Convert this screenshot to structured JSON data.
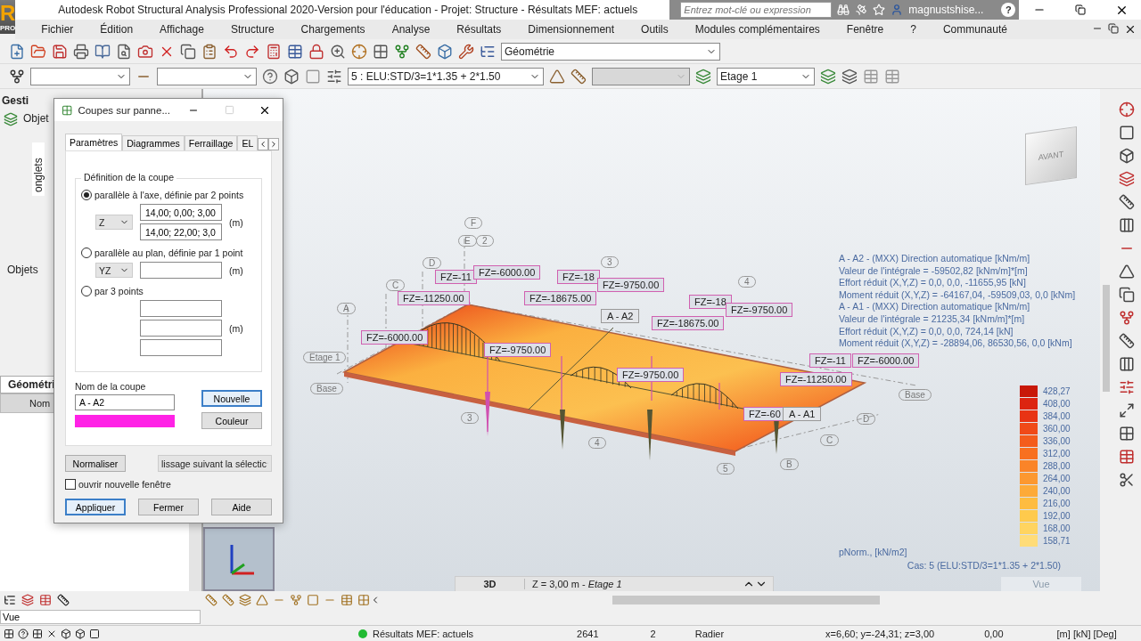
{
  "app": {
    "logo": "R",
    "edition": "PRO"
  },
  "window": {
    "title": "Autodesk Robot Structural Analysis Professional 2020-Version pour l'éducation - Projet: Structure - Résultats MEF: actuels",
    "search_placeholder": "Entrez mot-clé ou expression",
    "user": "magnustshise...",
    "help": "?"
  },
  "menu": [
    {
      "label": "Fichier"
    },
    {
      "label": "Édition"
    },
    {
      "label": "Affichage"
    },
    {
      "label": "Structure"
    },
    {
      "label": "Chargements"
    },
    {
      "label": "Analyse"
    },
    {
      "label": "Résultats"
    },
    {
      "label": "Dimensionnement"
    },
    {
      "label": "Outils"
    },
    {
      "label": "Modules complémentaires"
    },
    {
      "label": "Fenêtre"
    },
    {
      "label": "?"
    },
    {
      "label": "Communauté"
    }
  ],
  "toolbar": {
    "layout_combo": "Géométrie",
    "case_combo": "5 : ELU:STD/3=1*1.35 + 2*1.50",
    "story_combo": "Etage 1"
  },
  "left_panel": {
    "title": "Gesti",
    "side_tab": "onglets",
    "tree_header": "Objet",
    "tree": [
      {
        "label": "Objets"
      }
    ],
    "tab": "Géométri",
    "column": "Nom"
  },
  "dialog": {
    "title": "Coupes sur panne...",
    "tabs": [
      {
        "label": "Paramètres",
        "selected": true
      },
      {
        "label": "Diagrammes",
        "selected": false
      },
      {
        "label": "Ferraillage",
        "selected": false
      },
      {
        "label": "EL",
        "selected": false
      }
    ],
    "group_title": "Définition de la coupe",
    "options": [
      {
        "kind": "two_points",
        "label": "parallèle à l'axe, définie par 2 points",
        "selected": true,
        "axis": "Z",
        "points": [
          "14,00; 0,00; 3,00",
          "14,00; 22,00; 3,0"
        ],
        "unit": "(m)"
      },
      {
        "kind": "plane",
        "label": "parallèle au plan, définie par 1 point",
        "selected": false,
        "axis": "YZ",
        "unit": "(m)"
      },
      {
        "kind": "three_points",
        "label": "par 3 points",
        "selected": false,
        "unit": "(m)"
      }
    ],
    "name_label": "Nom de la coupe",
    "name_value": "A - A2",
    "color": "#ff22e6",
    "side_buttons": [
      {
        "label": "Nouvelle",
        "default": true
      },
      {
        "label": "Couleur",
        "default": false
      }
    ],
    "normalize": "Normaliser",
    "smoothing": "lissage suivant la sélectic",
    "new_window": {
      "label": "ouvrir nouvelle fenêtre",
      "checked": false
    },
    "buttons": [
      {
        "label": "Appliquer",
        "default": true
      },
      {
        "label": "Fermer",
        "default": false
      },
      {
        "label": "Aide",
        "default": false
      }
    ]
  },
  "viewport": {
    "cube_face": "AVANT",
    "loads": [
      "FZ=-11",
      "FZ=-6000.00",
      "FZ=-11250.00",
      "FZ=-18",
      "FZ=-9750.00",
      "FZ=-18675.00",
      "FZ=-18",
      "FZ=-9750.00",
      "FZ=-18675.00",
      "FZ=-6000.00",
      "FZ=-9750.00",
      "FZ=-9750.00",
      "FZ=-11",
      "FZ=-6000.00",
      "FZ=-11250.00",
      "FZ=-60"
    ],
    "sections": [
      "A - A2",
      "A - A1"
    ],
    "grid_marks": [
      "F",
      "E",
      "2",
      "D",
      "C",
      "A",
      "3",
      "4",
      "Etage 1",
      "Base",
      "3",
      "4",
      "5",
      "B",
      "C",
      "D",
      "Base"
    ],
    "info": [
      "A - A2 - (MXX) Direction automatique [kNm/m]",
      "Valeur de l'intégrale = -59502,82 [kNm/m]*[m]",
      "Effort réduit (X,Y,Z) = 0,0, 0,0, -11655,95 [kN]",
      "Moment réduit (X,Y,Z) = -64167,04, -59509,03, 0,0 [kNm]",
      "A - A1 - (MXX) Direction automatique [kNm/m]",
      "Valeur de l'intégrale = 21235,34 [kNm/m]*[m]",
      "Effort réduit (X,Y,Z) = 0,0, 0,0, 724,14 [kN]",
      "Moment réduit (X,Y,Z) = -28894,06, 86530,56, 0,0 [kNm]"
    ],
    "legend": [
      {
        "value": "428,27",
        "color": "#c81808"
      },
      {
        "value": "408,00",
        "color": "#dc2410"
      },
      {
        "value": "384,00",
        "color": "#e83414"
      },
      {
        "value": "360,00",
        "color": "#f04a18"
      },
      {
        "value": "336,00",
        "color": "#f45c1c"
      },
      {
        "value": "312,00",
        "color": "#f87020"
      },
      {
        "value": "288,00",
        "color": "#fa8428"
      },
      {
        "value": "264,00",
        "color": "#fc9830"
      },
      {
        "value": "240,00",
        "color": "#fdaa38"
      },
      {
        "value": "216,00",
        "color": "#febc40"
      },
      {
        "value": "192,00",
        "color": "#ffca4c"
      },
      {
        "value": "168,00",
        "color": "#ffd460"
      },
      {
        "value": "158,71",
        "color": "#ffdc78"
      }
    ],
    "legend_unit": "pNorm., [kN/m2]",
    "case_note": "Cas: 5 (ELU:STD/3=1*1.35 + 2*1.50)",
    "view_mode": "3D",
    "level_label": "Z = 3,00 m - *Etage 1*",
    "view_button": "Vue"
  },
  "command_field": "Vue",
  "status": {
    "results": "Résultats MEF: actuels",
    "count": "2641",
    "case": "2",
    "type": "Radier",
    "coords": "x=6,60; y=-24,31; z=3,00",
    "angle": "0,00",
    "units": "[m] [kN] [Deg]"
  }
}
